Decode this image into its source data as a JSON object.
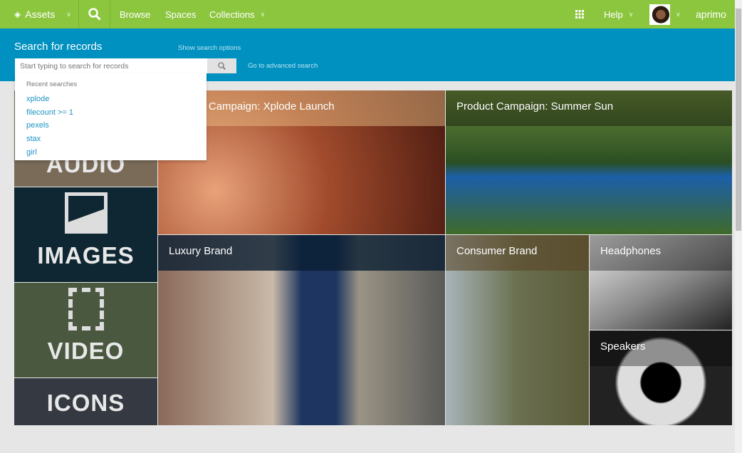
{
  "nav": {
    "app": "Assets",
    "items": [
      "Browse",
      "Spaces",
      "Collections"
    ],
    "help": "Help",
    "brand": "aprimo"
  },
  "search": {
    "title": "Search for records",
    "show_options": "Show search options",
    "placeholder": "Start typing to search for records",
    "advanced": "Go to advanced search",
    "recent_label": "Recent searches",
    "recent": [
      "xplode",
      "filecount >= 1",
      "pexels",
      "stax",
      "girl"
    ]
  },
  "categories": [
    "AUDIO",
    "IMAGES",
    "VIDEO",
    "ICONS"
  ],
  "tiles": [
    "Product Campaign: Xplode Launch",
    "Product Campaign: Summer Sun",
    "Luxury Brand",
    "Consumer Brand",
    "Headphones",
    "Speakers"
  ],
  "colors": {
    "nav": "#8cc63f",
    "search_band": "#0091c0",
    "link": "#1c94c4"
  }
}
